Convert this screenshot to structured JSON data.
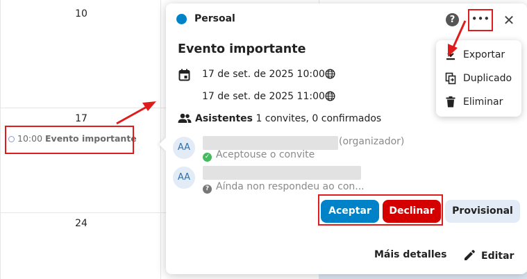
{
  "calendar": {
    "days": [
      {
        "num": "10"
      },
      {
        "num": "17"
      },
      {
        "num": "24"
      }
    ],
    "event_chip": {
      "time": "10:00",
      "title": "Evento importante"
    }
  },
  "popover": {
    "calendar_name": "Persoal",
    "calendar_color": "#0082c9",
    "title": "Evento importante",
    "start": "17 de set. de 2025 10:00",
    "end": "17 de set. de 2025 11:00",
    "attendees_label": "Asistentes",
    "attendees_summary": "1 convites, 0 confirmados",
    "attendees": [
      {
        "initials": "AA",
        "role": "(organizador)",
        "status": "Aceptouse o convite"
      },
      {
        "initials": "AA",
        "status": "Aínda non respondeu ao con..."
      }
    ],
    "actions": {
      "accept": "Aceptar",
      "decline": "Declinar",
      "tentative": "Provisional"
    },
    "footer": {
      "more_details": "Máis detalles",
      "edit": "Editar"
    }
  },
  "menu": {
    "items": [
      {
        "label": "Exportar",
        "icon": "download-icon"
      },
      {
        "label": "Duplicado",
        "icon": "duplicate-icon"
      },
      {
        "label": "Eliminar",
        "icon": "trash-icon"
      }
    ]
  },
  "colors": {
    "accent": "#0082c9",
    "decline": "#d40000",
    "annotation": "#e01b1b"
  }
}
